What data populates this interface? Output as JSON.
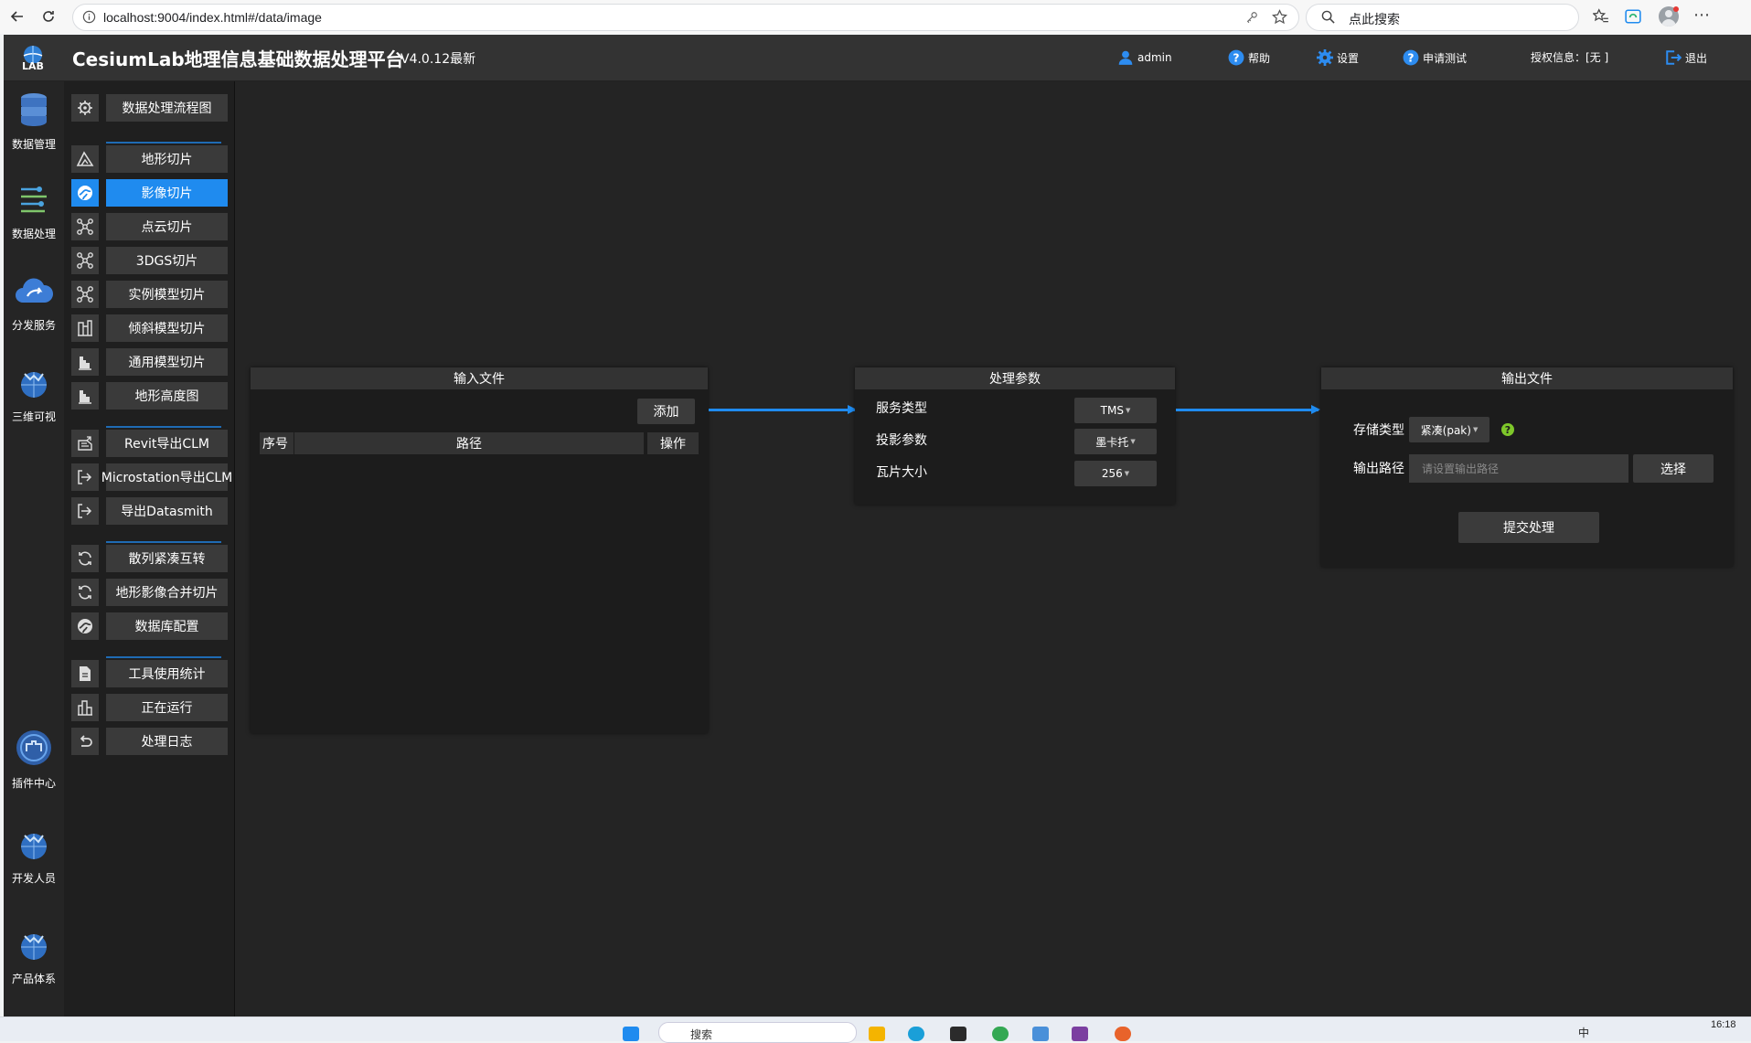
{
  "browser": {
    "url": "localhost:9004/index.html#/data/image",
    "search_placeholder": "点此搜索"
  },
  "header": {
    "title": "CesiumLab地理信息基础数据处理平台",
    "version": "V4.0.12最新",
    "user": "admin",
    "help": "帮助",
    "settings": "设置",
    "apply_test": "申请测试",
    "license": "授权信息：[无 ]",
    "logout": "退出"
  },
  "rail": {
    "logo_text": "LAB",
    "items": [
      {
        "label": "数据管理"
      },
      {
        "label": "数据处理"
      },
      {
        "label": "分发服务"
      },
      {
        "label": "三维可视"
      },
      {
        "label": "插件中心"
      },
      {
        "label": "开发人员"
      },
      {
        "label": "产品体系"
      }
    ]
  },
  "menu": {
    "items": [
      {
        "label": "数据处理流程图",
        "icon": "gear-icon"
      },
      {
        "label": "地形切片",
        "icon": "terrain-icon"
      },
      {
        "label": "影像切片",
        "icon": "globe-icon",
        "active": true
      },
      {
        "label": "点云切片",
        "icon": "nodes-icon"
      },
      {
        "label": "3DGS切片",
        "icon": "nodes-icon"
      },
      {
        "label": "实例模型切片",
        "icon": "nodes-icon"
      },
      {
        "label": "倾斜模型切片",
        "icon": "building-icon"
      },
      {
        "label": "通用模型切片",
        "icon": "model-icon"
      },
      {
        "label": "地形高度图",
        "icon": "model-icon"
      },
      {
        "label": "Revit导出CLM",
        "icon": "export-icon"
      },
      {
        "label": "Microstation导出CLM",
        "icon": "export-icon"
      },
      {
        "label": "导出Datasmith",
        "icon": "export-icon"
      },
      {
        "label": "散列紧凑互转",
        "icon": "refresh-icon"
      },
      {
        "label": "地形影像合并切片",
        "icon": "refresh-icon"
      },
      {
        "label": "数据库配置",
        "icon": "globe-icon"
      },
      {
        "label": "工具使用统计",
        "icon": "document-icon"
      },
      {
        "label": "正在运行",
        "icon": "building-icon"
      },
      {
        "label": "处理日志",
        "icon": "undo-icon"
      }
    ]
  },
  "input_panel": {
    "title": "输入文件",
    "add_label": "添加",
    "columns": [
      "序号",
      "路径",
      "操作"
    ]
  },
  "params_panel": {
    "title": "处理参数",
    "service_type_label": "服务类型",
    "service_type_value": "TMS",
    "projection_label": "投影参数",
    "projection_value": "墨卡托",
    "tile_size_label": "瓦片大小",
    "tile_size_value": "256"
  },
  "output_panel": {
    "title": "输出文件",
    "storage_label": "存储类型",
    "storage_value": "紧凑(pak)",
    "path_label": "输出路径",
    "path_placeholder": "请设置输出路径",
    "choose_label": "选择",
    "submit_label": "提交处理"
  },
  "taskbar": {
    "search": "搜索",
    "ime": "中",
    "time": "16:18"
  },
  "colors": {
    "accent": "#1f8bef",
    "background": "#242424",
    "panel_header": "#333333"
  }
}
